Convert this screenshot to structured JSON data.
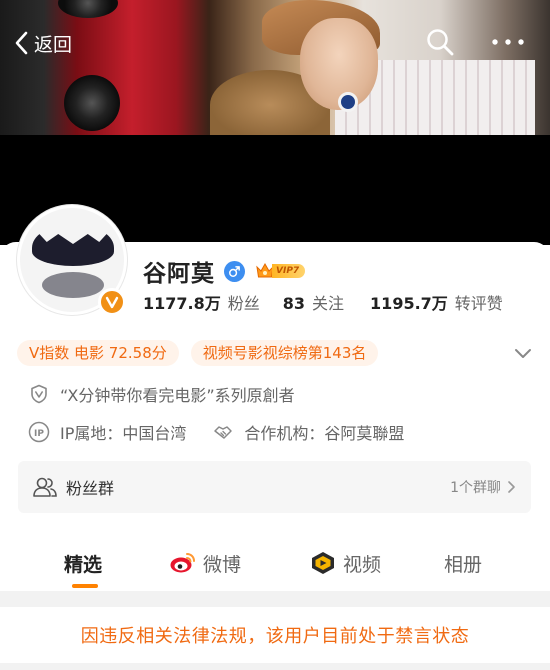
{
  "nav": {
    "back_label": "返回"
  },
  "profile": {
    "name": "谷阿莫",
    "gender": "male",
    "vip_level": "VIP7",
    "stats": [
      {
        "value": "1177.8万",
        "label": "粉丝"
      },
      {
        "value": "83",
        "label": "关注"
      },
      {
        "value": "1195.7万",
        "label": "转评赞"
      }
    ],
    "tags": [
      "V指数 电影 72.58分",
      "视频号影视综榜第143名"
    ],
    "verification": "“X分钟带你看完电影”系列原創者",
    "ip_location": "IP属地：中国台湾",
    "agency": "合作机构：谷阿莫聯盟"
  },
  "fan_group": {
    "label": "粉丝群",
    "count": "1个群聊"
  },
  "tabs": [
    {
      "label": "精选",
      "active": true
    },
    {
      "label": "微博",
      "active": false
    },
    {
      "label": "视频",
      "active": false
    },
    {
      "label": "相册",
      "active": false
    }
  ],
  "notice": "因违反相关法律法规，该用户目前处于禁言状态",
  "colors": {
    "accent": "#ff8200",
    "tag_text": "#f06a12",
    "tag_bg": "#fff3ea",
    "verified": "#f19016"
  }
}
